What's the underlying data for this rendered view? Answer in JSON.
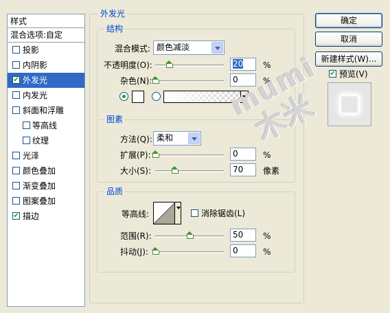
{
  "style_panel": {
    "header": "样式",
    "blend_options": "混合选项:自定",
    "items": [
      {
        "label": "投影",
        "checked": false,
        "sub": false
      },
      {
        "label": "内阴影",
        "checked": false,
        "sub": false
      },
      {
        "label": "外发光",
        "checked": true,
        "sub": false,
        "selected": true
      },
      {
        "label": "内发光",
        "checked": false,
        "sub": false
      },
      {
        "label": "斜面和浮雕",
        "checked": false,
        "sub": false
      },
      {
        "label": "等高线",
        "checked": false,
        "sub": true
      },
      {
        "label": "纹理",
        "checked": false,
        "sub": true
      },
      {
        "label": "光泽",
        "checked": false,
        "sub": false
      },
      {
        "label": "颜色叠加",
        "checked": false,
        "sub": false
      },
      {
        "label": "渐变叠加",
        "checked": false,
        "sub": false
      },
      {
        "label": "图案叠加",
        "checked": false,
        "sub": false
      },
      {
        "label": "描边",
        "checked": true,
        "sub": false
      }
    ]
  },
  "outer_glow": {
    "title": "外发光",
    "structure": {
      "title": "结构",
      "blend_mode_label": "混合模式:",
      "blend_mode_value": "颜色减淡",
      "opacity_label": "不透明度(O):",
      "opacity_value": "20",
      "opacity_unit": "%",
      "opacity_level": 20,
      "noise_label": "杂色(N):",
      "noise_value": "0",
      "noise_unit": "%",
      "noise_level": 0
    },
    "elements": {
      "title": "图素",
      "technique_label": "方法(Q):",
      "technique_value": "柔和",
      "spread_label": "扩展(P):",
      "spread_value": "0",
      "spread_unit": "%",
      "spread_level": 0,
      "size_label": "大小(S):",
      "size_value": "70",
      "size_unit": "像素",
      "size_level": 28
    },
    "quality": {
      "title": "品质",
      "contour_label": "等高线:",
      "antialias_label": "消除锯齿(L)",
      "antialias_checked": false,
      "range_label": "范围(R):",
      "range_value": "50",
      "range_unit": "%",
      "range_level": 50,
      "jitter_label": "抖动(J):",
      "jitter_value": "0",
      "jitter_unit": "%",
      "jitter_level": 0
    }
  },
  "buttons": {
    "ok": "确定",
    "cancel": "取消",
    "new_style": "新建样式(W)...",
    "preview_label": "预览(V)",
    "preview_checked": true
  },
  "watermark": {
    "line1": "mumi",
    "line2": "木米"
  },
  "colors": {
    "selection": "#316ac5",
    "legend_text": "#0046d5",
    "dialog_bg": "#ece9d8"
  }
}
